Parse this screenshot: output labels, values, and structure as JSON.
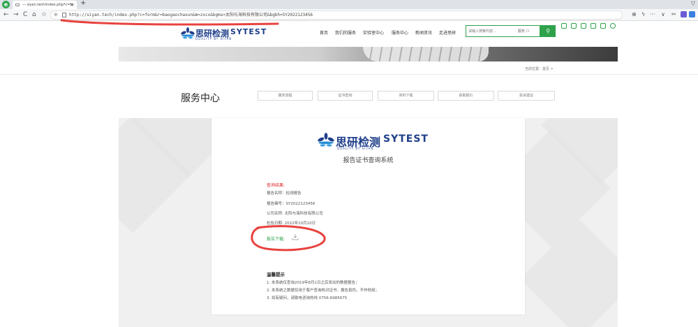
{
  "browser": {
    "tab_title": "— siyan.tech/index.php?c=fo:",
    "url": "http://siyan.tech/index.php?c=form&r=baogaochaxun&m=zxcx&bgms=太阳与海科技有限公司&bgbh=SY2022123456",
    "new_tab": "+",
    "menu_glyph": "▽",
    "close_glyph": "×",
    "back": "←",
    "forward": "→",
    "reload": "C",
    "home": "⌂",
    "star": "☆",
    "zoom": "⊕",
    "bolt": "ϟ",
    "more": "···",
    "chevron": "∨",
    "cut": "✂"
  },
  "site": {
    "logo_cn": "思研检测",
    "logo_en": "SYTEST",
    "logo_sub": "QUALITY BY SIYAN",
    "nav": [
      "首页",
      "我们的服务",
      "实验室中心",
      "服务中心",
      "新闻资讯",
      "走进思研"
    ],
    "search_placeholder": "请输入搜索内容...",
    "search_scope": "服务 ☐",
    "search_icon_glyph": "⚲",
    "breadcrumb": "当前位置：首页 >"
  },
  "service": {
    "title": "服务中心",
    "tabs": [
      "服务流程",
      "证书查询",
      "资料下载",
      "获取报价",
      "投诉建议"
    ]
  },
  "report": {
    "system_title": "报告证书查询系统",
    "result_label": "查询结果:",
    "fields": [
      "报告名称：检测报告",
      "报告编号：SY2022123456",
      "公司名称: 太阳与海科技有限公司",
      "检验日期: 2022年10月10日"
    ],
    "download_label": "报告下载:",
    "tips_title": "温馨提示",
    "tips": [
      "1. 本系统仅查询2019年8月1日之后发出的数据报告；",
      "2. 本系统之数据仅用于客户查询核对证书、报告真伪，不作他用；",
      "3. 如有疑问，请致电咨询热线 0756-6985675"
    ]
  },
  "colors": {
    "brand_blue": "#1e3f8a",
    "brand_green": "#2fa24b",
    "alert_red": "#e0262b",
    "annotation_red": "#e8423f"
  }
}
